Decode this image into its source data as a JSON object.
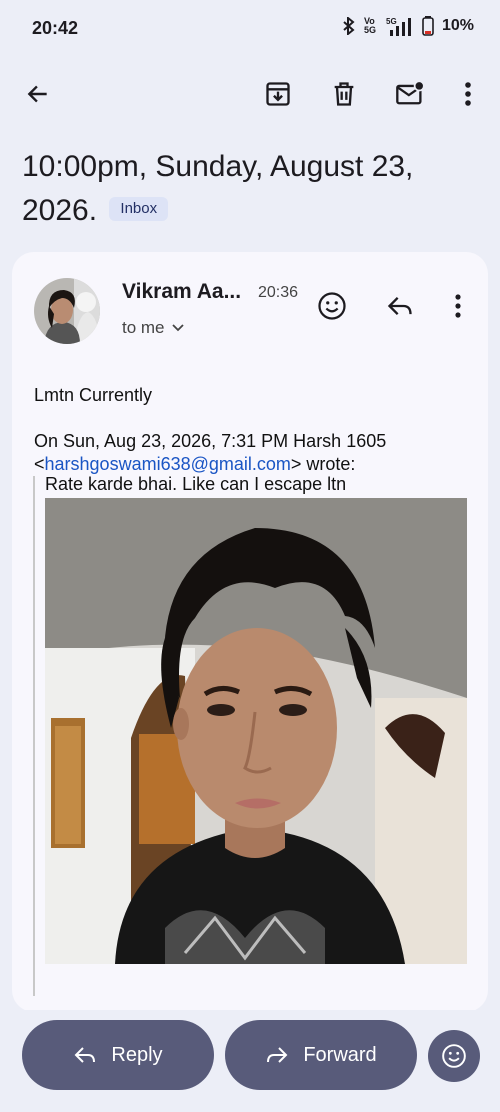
{
  "status": {
    "time": "20:42",
    "network": "5G",
    "battery": "10%",
    "volte": "Vo 5G"
  },
  "subject": {
    "text": "10:00pm, Sunday, August 23, 2026.",
    "label": "Inbox"
  },
  "message": {
    "sender": "Vikram Aa...",
    "time": "20:36",
    "recipient": "to me",
    "body": "Lmtn Currently",
    "quote_header_prefix": "On Sun, Aug 23, 2026, 7:31 PM Harsh 1605",
    "quote_email": "harshgoswami638@gmail.com",
    "quote_header_suffix": "wrote:",
    "quoted_text": "Rate karde bhai. Like can I escape ltn"
  },
  "actions": {
    "reply": "Reply",
    "forward": "Forward"
  },
  "icons": [
    "back-arrow-icon",
    "archive-icon",
    "delete-icon",
    "mark-unread-icon",
    "more-vert-icon",
    "emoji-icon",
    "reply-icon",
    "chevron-down-icon",
    "forward-icon"
  ]
}
